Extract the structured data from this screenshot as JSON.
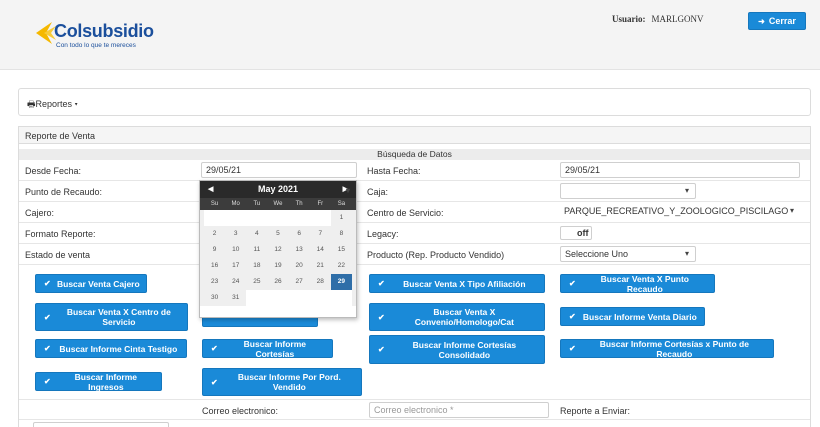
{
  "header": {
    "logo_name": "Colsubsidio",
    "logo_tagline": "Con todo lo que te mereces",
    "user_label": "Usuario:",
    "user_name": "MARLGONV",
    "logout_label": "Cerrar",
    "brand_color": "#1b4f9c",
    "accent_color": "#1a8ad8"
  },
  "menu": {
    "reports_label": "Reportes"
  },
  "panel": {
    "title": "Reporte de Venta",
    "section_title": "Búsqueda de Datos"
  },
  "form": {
    "desde_label": "Desde Fecha:",
    "desde_value": "29/05/21",
    "hasta_label": "Hasta Fecha:",
    "hasta_value": "29/05/21",
    "punto_label": "Punto de Recaudo:",
    "caja_label": "Caja:",
    "caja_value": "",
    "cajero_label": "Cajero:",
    "centro_label": "Centro de Servicio:",
    "centro_value": "PARQUE_RECREATIVO_Y_ZOOLOGICO_PISCILAGO",
    "formato_label": "Formato Reporte:",
    "legacy_label": "Legacy:",
    "legacy_value": "off",
    "estado_label": "Estado de venta",
    "producto_label": "Producto (Rep. Producto Vendido)",
    "producto_value": "Seleccione Uno",
    "correo_label": "Correo electronico:",
    "correo_placeholder": "Correo electronico *",
    "reporte_enviar_label": "Reporte a Enviar:"
  },
  "buttons": {
    "venta_cajero": "Buscar Venta Cajero",
    "venta_tipo_afiliacion": "Buscar Venta X Tipo Afiliación",
    "venta_punto_recaudo": "Buscar Venta X Punto Recaudo",
    "venta_centro_servicio": "Buscar Venta X Centro de Servicio",
    "venta_convenio": "Buscar Venta X Convenio/Homologo/Cat",
    "informe_venta_diario": "Buscar Informe Venta Diario",
    "informe_cinta_testigo": "Buscar Informe Cinta Testigo",
    "informe_cortesias": "Buscar Informe Cortesías",
    "informe_cortesias_consolidado": "Buscar Informe Cortesías Consolidado",
    "informe_cortesias_punto": "Buscar Informe Cortesías x Punto de Recaudo",
    "informe_ingresos": "Buscar Informe Ingresos",
    "informe_producto_vendido": "Buscar Informe Por Pord. Vendido"
  },
  "calendar": {
    "month_label": "May 2021",
    "prev_label": "◀",
    "next_label": "▶",
    "weekdays": [
      "Su",
      "Mo",
      "Tu",
      "We",
      "Th",
      "Fr",
      "Sa"
    ],
    "weeks": [
      [
        "",
        "",
        "",
        "",
        "",
        "",
        "1"
      ],
      [
        "2",
        "3",
        "4",
        "5",
        "6",
        "7",
        "8"
      ],
      [
        "9",
        "10",
        "11",
        "12",
        "13",
        "14",
        "15"
      ],
      [
        "16",
        "17",
        "18",
        "19",
        "20",
        "21",
        "22"
      ],
      [
        "23",
        "24",
        "25",
        "26",
        "27",
        "28",
        "29"
      ],
      [
        "30",
        "31",
        "",
        "",
        "",
        "",
        ""
      ]
    ],
    "selected_day": "29"
  }
}
